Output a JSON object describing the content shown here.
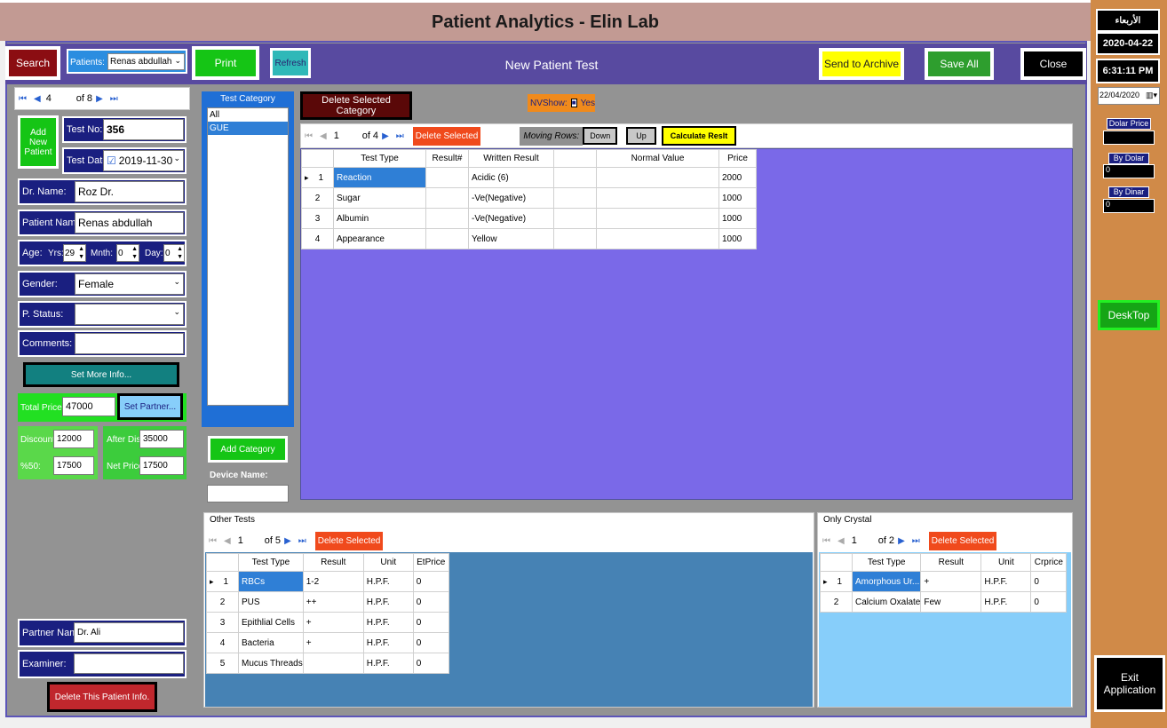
{
  "app": {
    "title": "Patient Analytics - Elin Lab"
  },
  "toolbar": {
    "search": "Search",
    "patients_label": "Patients:",
    "patients_value": "Renas abdullah",
    "print": "Print",
    "refresh": "Refresh",
    "page_title": "New Patient Test",
    "send_archive": "Send to Archive",
    "save_all": "Save All",
    "close": "Close"
  },
  "patient_nav": {
    "current": "4",
    "of": "of 8"
  },
  "form": {
    "add_new_patient": "Add New Patient",
    "test_no_label": "Test No:",
    "test_no": "356",
    "test_date_label": "Test Date:",
    "test_date": "2019-11-30",
    "dr_name_label": "Dr. Name:",
    "dr_name": "Roz Dr.",
    "patient_name_label": "Patient Name:",
    "patient_name": "Renas abdullah",
    "age_label": "Age:",
    "yrs_label": "Yrs:",
    "yrs": "29",
    "mnth_label": "Mnth:",
    "mnth": "0",
    "day_label": "Day:",
    "day": "0",
    "gender_label": "Gender:",
    "gender": "Female",
    "pstatus_label": "P. Status:",
    "pstatus": "",
    "comments_label": "Comments:",
    "comments": "",
    "set_more_info": "Set More Info...",
    "total_price_label": "Total Price:",
    "total_price": "47000",
    "set_partner": "Set Partner...",
    "discount_label": "Discount:",
    "discount": "12000",
    "after_dis_label": "After Dis:",
    "after_dis": "35000",
    "pct50_label": "%50:",
    "pct50": "17500",
    "net_price_label": "Net Price:",
    "net_price": "17500",
    "partner_name_label": "Partner Name:",
    "partner_name": "Dr. Ali",
    "examiner_label": "Examiner:",
    "examiner": "",
    "delete_patient": "Delete This Patient Info."
  },
  "category": {
    "header": "Test Category",
    "items": [
      "All",
      "GUE"
    ],
    "add_category": "Add Category",
    "device_name_label": "Device Name:"
  },
  "main_grid": {
    "delete_selected_category": "Delete Selected Category",
    "nvshow_label": "NVShow:",
    "nvshow_value": "Yes",
    "nav_current": "1",
    "nav_of": "of 4",
    "delete_selected": "Delete Selected",
    "moving_rows_label": "Moving Rows:",
    "down": "Down",
    "up": "Up",
    "calculate": "Calculate Reslt",
    "columns": [
      "Test Type",
      "Result#",
      "Written Result",
      "",
      "Normal Value",
      "Price"
    ],
    "rows": [
      [
        "1",
        "Reaction",
        "",
        "Acidic (6)",
        "",
        "",
        "2000"
      ],
      [
        "2",
        "Sugar",
        "",
        "-Ve(Negative)",
        "",
        "",
        "1000"
      ],
      [
        "3",
        "Albumin",
        "",
        "-Ve(Negative)",
        "",
        "",
        "1000"
      ],
      [
        "4",
        "Appearance",
        "",
        "Yellow",
        "",
        "",
        "1000"
      ]
    ]
  },
  "other_tests": {
    "header": "Other Tests",
    "nav_current": "1",
    "nav_of": "of 5",
    "delete_selected": "Delete Selected",
    "columns": [
      "Test Type",
      "Result",
      "Unit",
      "EtPrice"
    ],
    "rows": [
      [
        "1",
        "RBCs",
        "1-2",
        "H.P.F.",
        "0"
      ],
      [
        "2",
        "PUS",
        "++",
        "H.P.F.",
        "0"
      ],
      [
        "3",
        "Epithlial Cells",
        "+",
        "H.P.F.",
        "0"
      ],
      [
        "4",
        "Bacteria",
        "+",
        "H.P.F.",
        "0"
      ],
      [
        "5",
        "Mucus Threads",
        "",
        "H.P.F.",
        "0"
      ]
    ]
  },
  "crystal": {
    "header": "Only Crystal",
    "nav_current": "1",
    "nav_of": "of 2",
    "delete_selected": "Delete Selected",
    "columns": [
      "Test Type",
      "Result",
      "Unit",
      "Crprice"
    ],
    "rows": [
      [
        "1",
        "Amorphous Ur...",
        "+",
        "H.P.F.",
        "0"
      ],
      [
        "2",
        "Calcium  Oxalate",
        "Few",
        "H.P.F.",
        "0"
      ]
    ]
  },
  "sidebar": {
    "weekday": "الأربعاء",
    "date": "2020-04-22",
    "time": "6:31:11 PM",
    "picker_date": "22/04/2020",
    "dolar_price_label": "Dolar Price",
    "dolar_price": "",
    "by_dolar_label": "By Dolar",
    "by_dolar": "0",
    "by_dinar_label": "By Dinar",
    "by_dinar": "0",
    "desktop": "DeskTop",
    "exit": "Exit Application"
  },
  "colors": {
    "toolbar": "#584aa0",
    "grid_bg": "#7a69e8",
    "lower_grid_bg": "#4682b4",
    "crystal_bg": "#87cefa",
    "side": "#d08a48"
  }
}
